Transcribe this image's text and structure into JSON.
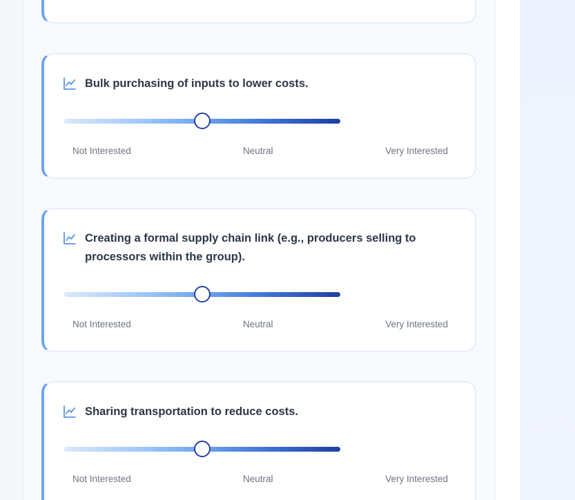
{
  "scale_labels": {
    "left": "Not Interested",
    "middle": "Neutral",
    "right": "Very Interested"
  },
  "questions": [
    {
      "text": "Bulk purchasing of inputs to lower costs.",
      "value_fraction": 0.5,
      "icon": "chart-line-icon"
    },
    {
      "text": "Creating a formal supply chain link (e.g., producers selling to processors within the group).",
      "value_fraction": 0.5,
      "icon": "chart-line-icon"
    },
    {
      "text": "Sharing transportation to reduce costs.",
      "value_fraction": 0.5,
      "icon": "chart-line-icon"
    }
  ],
  "colors": {
    "accent_border": "#6aa3f5",
    "icon": "#5b93ea",
    "thumb_border": "#2340a6",
    "slider_start": "#dbe9fb",
    "slider_end": "#1f3ea0"
  }
}
